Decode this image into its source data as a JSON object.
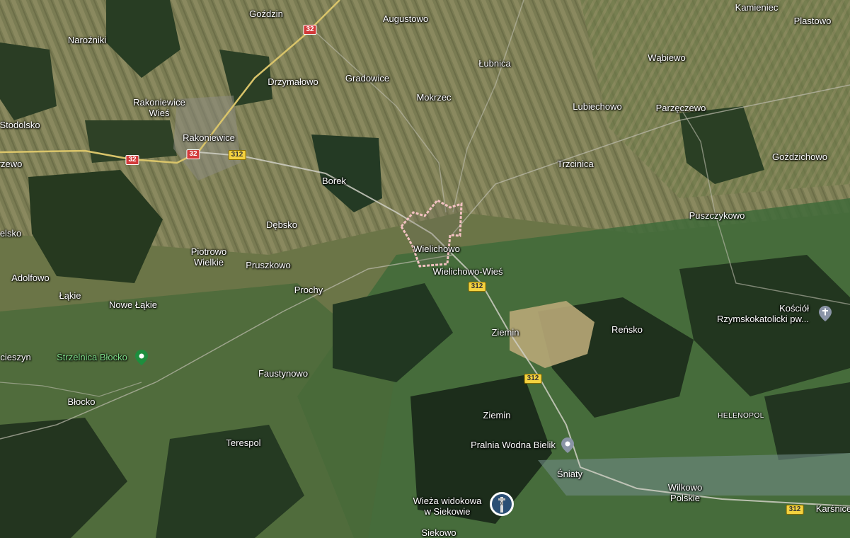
{
  "map": {
    "highlight_area": "Wielichowo",
    "places": [
      {
        "name": "Goździn"
      },
      {
        "name": "Augustowo"
      },
      {
        "name": "Kamieniec"
      },
      {
        "name": "Plastowo"
      },
      {
        "name": "Naroźniki"
      },
      {
        "name": "Wąbiewo"
      },
      {
        "name": "Łubnica"
      },
      {
        "name": "Drzymałowo"
      },
      {
        "name": "Gradowice"
      },
      {
        "name": "Mokrzec"
      },
      {
        "name": "Rakoniewice\nWieś"
      },
      {
        "name": "Lubiechowo"
      },
      {
        "name": "Parzęczewo"
      },
      {
        "name": "Stodolsko"
      },
      {
        "name": "Rakoniewice"
      },
      {
        "name": "Goździchowo"
      },
      {
        "name": "rzewo"
      },
      {
        "name": "Trzcinica"
      },
      {
        "name": "Borek"
      },
      {
        "name": "Puszczykowo"
      },
      {
        "name": "Dębsko"
      },
      {
        "name": "elsko"
      },
      {
        "name": "Wielichowo"
      },
      {
        "name": "Piotrowo\nWielkie"
      },
      {
        "name": "Pruszkowo"
      },
      {
        "name": "Wielichowo-Wieś"
      },
      {
        "name": "Adolfowo"
      },
      {
        "name": "Prochy"
      },
      {
        "name": "Łąkie"
      },
      {
        "name": "Nowe Łąkie"
      },
      {
        "name": "Ziemin"
      },
      {
        "name": "Reńsko"
      },
      {
        "name": "cieszyn"
      },
      {
        "name": "Faustynowo"
      },
      {
        "name": "Błocko"
      },
      {
        "name": "Ziemin"
      },
      {
        "name": "HELENOPOL"
      },
      {
        "name": "Terespol"
      },
      {
        "name": "Śniaty"
      },
      {
        "name": "Wilkowo\nPolskie"
      },
      {
        "name": "Karśnice"
      },
      {
        "name": "Siekowo"
      }
    ],
    "pois": [
      {
        "name": "Strzelnica Błocko"
      },
      {
        "name": "Pralnia Wodna Bielik"
      },
      {
        "name": "Kościół\nRzymskokatolicki pw..."
      },
      {
        "name": "Wieża widokowa\nw Siekowie"
      }
    ],
    "road_shields": [
      {
        "label": "32",
        "color": "red"
      },
      {
        "label": "32",
        "color": "red"
      },
      {
        "label": "32",
        "color": "red"
      },
      {
        "label": "312",
        "color": "yellow"
      },
      {
        "label": "312",
        "color": "yellow"
      },
      {
        "label": "312",
        "color": "yellow"
      },
      {
        "label": "312",
        "color": "yellow"
      }
    ],
    "colors": {
      "terrain": "#6b7547",
      "forest": "#243a24",
      "meadow": "#3f6b3a",
      "field_light": "#8c8a63",
      "boundary": "#e06060",
      "road_major": "#d9c46a"
    }
  }
}
